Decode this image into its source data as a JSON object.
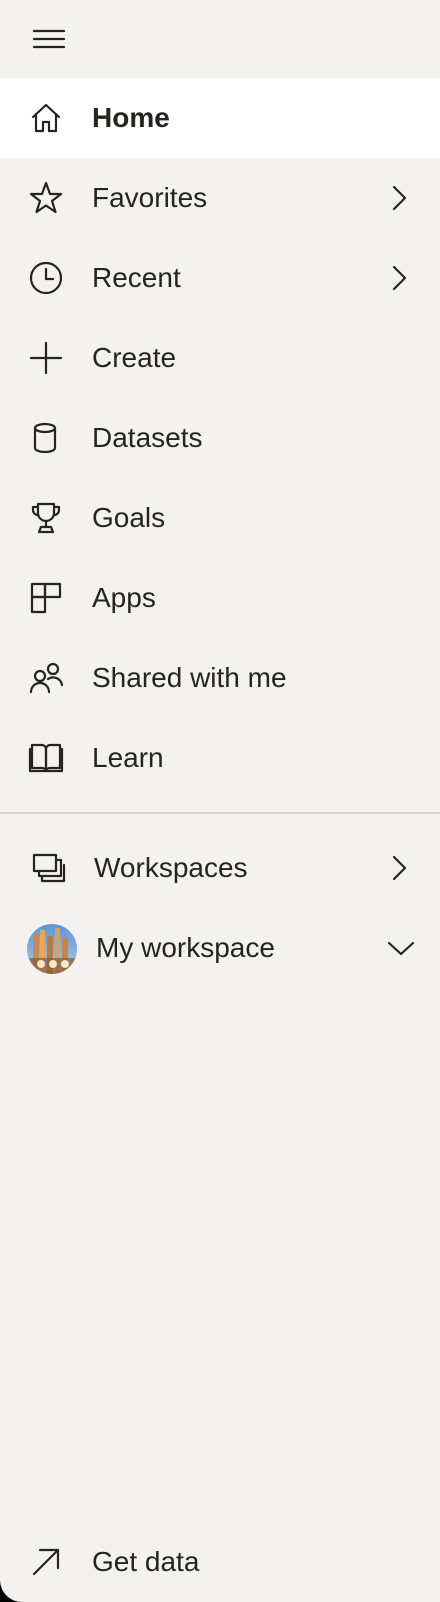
{
  "nav": {
    "menu_toggle": "Navigation menu",
    "items": [
      {
        "label": "Home",
        "icon": "home-icon"
      },
      {
        "label": "Favorites",
        "icon": "star-icon"
      },
      {
        "label": "Recent",
        "icon": "clock-icon"
      },
      {
        "label": "Create",
        "icon": "plus-icon"
      },
      {
        "label": "Datasets",
        "icon": "cylinder-icon"
      },
      {
        "label": "Goals",
        "icon": "trophy-icon"
      },
      {
        "label": "Apps",
        "icon": "apps-icon"
      },
      {
        "label": "Shared with me",
        "icon": "people-icon"
      },
      {
        "label": "Learn",
        "icon": "book-icon"
      }
    ],
    "workspaces": {
      "label": "Workspaces",
      "icon": "workspaces-icon"
    },
    "my_workspace": {
      "label": "My workspace",
      "icon": "avatar"
    },
    "get_data": {
      "label": "Get data",
      "icon": "arrow-up-right-icon"
    },
    "colors": {
      "background": "#f3f2f1",
      "selected_background": "#ffffff",
      "text": "#252423"
    }
  }
}
